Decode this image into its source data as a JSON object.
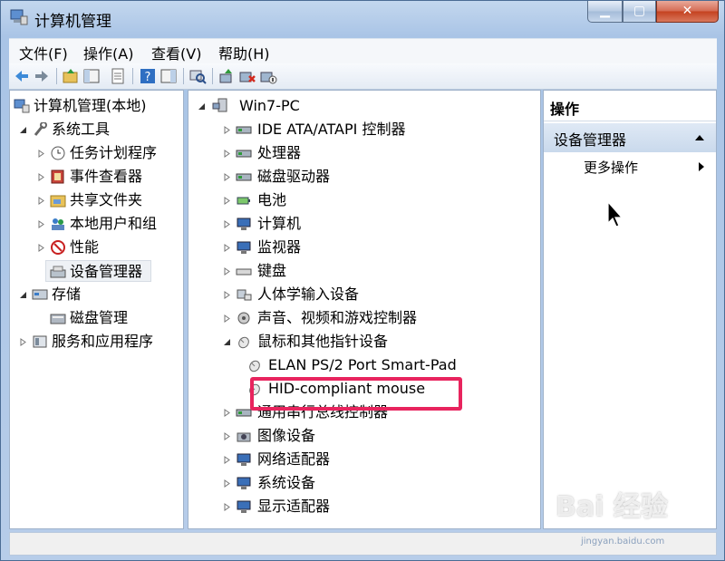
{
  "window": {
    "title": "计算机管理"
  },
  "menu": [
    "文件(F)",
    "操作(A)",
    "查看(V)",
    "帮助(H)"
  ],
  "left_tree": [
    {
      "label": "计算机管理(本地)",
      "icon": "computer-management-icon"
    },
    {
      "label": "系统工具",
      "icon": "tools-icon"
    },
    {
      "label": "任务计划程序",
      "icon": "clock-icon"
    },
    {
      "label": "事件查看器",
      "icon": "event-viewer-icon"
    },
    {
      "label": "共享文件夹",
      "icon": "shared-folder-icon"
    },
    {
      "label": "本地用户和组",
      "icon": "users-icon"
    },
    {
      "label": "性能",
      "icon": "performance-icon"
    },
    {
      "label": "设备管理器",
      "icon": "device-manager-icon"
    },
    {
      "label": "存储",
      "icon": "storage-icon"
    },
    {
      "label": "磁盘管理",
      "icon": "disk-icon"
    },
    {
      "label": "服务和应用程序",
      "icon": "services-icon"
    }
  ],
  "device_tree": {
    "root": "Win7-PC",
    "categories": [
      "IDE ATA/ATAPI 控制器",
      "处理器",
      "磁盘驱动器",
      "电池",
      "计算机",
      "监视器",
      "键盘",
      "人体学输入设备",
      "声音、视频和游戏控制器",
      "鼠标和其他指针设备",
      "通用串行总线控制器",
      "图像设备",
      "网络适配器",
      "系统设备",
      "显示适配器"
    ],
    "mouse_children": [
      "ELAN PS/2 Port Smart-Pad",
      "HID-compliant mouse"
    ]
  },
  "actions": {
    "header": "操作",
    "section": "设备管理器",
    "more": "更多操作"
  },
  "watermark": {
    "brand": "Bai 经验",
    "site": "jingyan.baidu.com"
  }
}
